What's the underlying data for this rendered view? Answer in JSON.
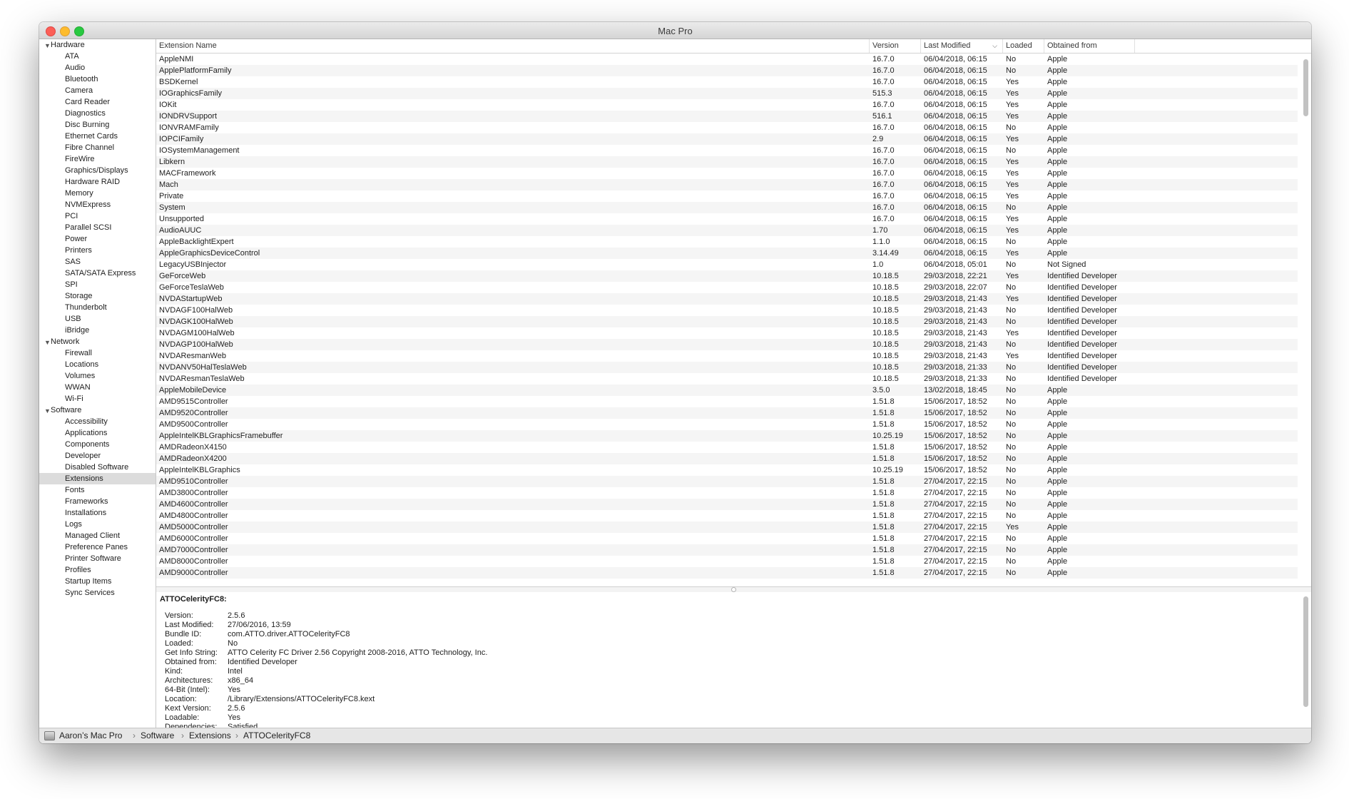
{
  "window": {
    "title": "Mac Pro"
  },
  "sidebar": {
    "items": [
      {
        "label": "Hardware",
        "kind": "cat"
      },
      {
        "label": "ATA",
        "kind": "child"
      },
      {
        "label": "Audio",
        "kind": "child"
      },
      {
        "label": "Bluetooth",
        "kind": "child"
      },
      {
        "label": "Camera",
        "kind": "child"
      },
      {
        "label": "Card Reader",
        "kind": "child"
      },
      {
        "label": "Diagnostics",
        "kind": "child"
      },
      {
        "label": "Disc Burning",
        "kind": "child"
      },
      {
        "label": "Ethernet Cards",
        "kind": "child"
      },
      {
        "label": "Fibre Channel",
        "kind": "child"
      },
      {
        "label": "FireWire",
        "kind": "child"
      },
      {
        "label": "Graphics/Displays",
        "kind": "child"
      },
      {
        "label": "Hardware RAID",
        "kind": "child"
      },
      {
        "label": "Memory",
        "kind": "child"
      },
      {
        "label": "NVMExpress",
        "kind": "child"
      },
      {
        "label": "PCI",
        "kind": "child"
      },
      {
        "label": "Parallel SCSI",
        "kind": "child"
      },
      {
        "label": "Power",
        "kind": "child"
      },
      {
        "label": "Printers",
        "kind": "child"
      },
      {
        "label": "SAS",
        "kind": "child"
      },
      {
        "label": "SATA/SATA Express",
        "kind": "child"
      },
      {
        "label": "SPI",
        "kind": "child"
      },
      {
        "label": "Storage",
        "kind": "child"
      },
      {
        "label": "Thunderbolt",
        "kind": "child"
      },
      {
        "label": "USB",
        "kind": "child"
      },
      {
        "label": "iBridge",
        "kind": "child"
      },
      {
        "label": "Network",
        "kind": "cat"
      },
      {
        "label": "Firewall",
        "kind": "child"
      },
      {
        "label": "Locations",
        "kind": "child"
      },
      {
        "label": "Volumes",
        "kind": "child"
      },
      {
        "label": "WWAN",
        "kind": "child"
      },
      {
        "label": "Wi-Fi",
        "kind": "child"
      },
      {
        "label": "Software",
        "kind": "cat"
      },
      {
        "label": "Accessibility",
        "kind": "child"
      },
      {
        "label": "Applications",
        "kind": "child"
      },
      {
        "label": "Components",
        "kind": "child"
      },
      {
        "label": "Developer",
        "kind": "child"
      },
      {
        "label": "Disabled Software",
        "kind": "child"
      },
      {
        "label": "Extensions",
        "kind": "child",
        "selected": true
      },
      {
        "label": "Fonts",
        "kind": "child"
      },
      {
        "label": "Frameworks",
        "kind": "child"
      },
      {
        "label": "Installations",
        "kind": "child"
      },
      {
        "label": "Logs",
        "kind": "child"
      },
      {
        "label": "Managed Client",
        "kind": "child"
      },
      {
        "label": "Preference Panes",
        "kind": "child"
      },
      {
        "label": "Printer Software",
        "kind": "child"
      },
      {
        "label": "Profiles",
        "kind": "child"
      },
      {
        "label": "Startup Items",
        "kind": "child"
      },
      {
        "label": "Sync Services",
        "kind": "child"
      }
    ]
  },
  "table": {
    "columns": [
      "Extension Name",
      "Version",
      "Last Modified",
      "Loaded",
      "Obtained from"
    ],
    "sort_icon": "chevron-down-icon",
    "rows": [
      [
        "AppleNMI",
        "16.7.0",
        "06/04/2018, 06:15",
        "No",
        "Apple"
      ],
      [
        "ApplePlatformFamily",
        "16.7.0",
        "06/04/2018, 06:15",
        "No",
        "Apple"
      ],
      [
        "BSDKernel",
        "16.7.0",
        "06/04/2018, 06:15",
        "Yes",
        "Apple"
      ],
      [
        "IOGraphicsFamily",
        "515.3",
        "06/04/2018, 06:15",
        "Yes",
        "Apple"
      ],
      [
        "IOKit",
        "16.7.0",
        "06/04/2018, 06:15",
        "Yes",
        "Apple"
      ],
      [
        "IONDRVSupport",
        "516.1",
        "06/04/2018, 06:15",
        "Yes",
        "Apple"
      ],
      [
        "IONVRAMFamily",
        "16.7.0",
        "06/04/2018, 06:15",
        "No",
        "Apple"
      ],
      [
        "IOPCIFamily",
        "2.9",
        "06/04/2018, 06:15",
        "Yes",
        "Apple"
      ],
      [
        "IOSystemManagement",
        "16.7.0",
        "06/04/2018, 06:15",
        "No",
        "Apple"
      ],
      [
        "Libkern",
        "16.7.0",
        "06/04/2018, 06:15",
        "Yes",
        "Apple"
      ],
      [
        "MACFramework",
        "16.7.0",
        "06/04/2018, 06:15",
        "Yes",
        "Apple"
      ],
      [
        "Mach",
        "16.7.0",
        "06/04/2018, 06:15",
        "Yes",
        "Apple"
      ],
      [
        "Private",
        "16.7.0",
        "06/04/2018, 06:15",
        "Yes",
        "Apple"
      ],
      [
        "System",
        "16.7.0",
        "06/04/2018, 06:15",
        "No",
        "Apple"
      ],
      [
        "Unsupported",
        "16.7.0",
        "06/04/2018, 06:15",
        "Yes",
        "Apple"
      ],
      [
        "AudioAUUC",
        "1.70",
        "06/04/2018, 06:15",
        "Yes",
        "Apple"
      ],
      [
        "AppleBacklightExpert",
        "1.1.0",
        "06/04/2018, 06:15",
        "No",
        "Apple"
      ],
      [
        "AppleGraphicsDeviceControl",
        "3.14.49",
        "06/04/2018, 06:15",
        "Yes",
        "Apple"
      ],
      [
        "LegacyUSBInjector",
        "1.0",
        "06/04/2018, 05:01",
        "No",
        "Not Signed"
      ],
      [
        "GeForceWeb",
        "10.18.5",
        "29/03/2018, 22:21",
        "Yes",
        "Identified Developer"
      ],
      [
        "GeForceTeslaWeb",
        "10.18.5",
        "29/03/2018, 22:07",
        "No",
        "Identified Developer"
      ],
      [
        "NVDAStartupWeb",
        "10.18.5",
        "29/03/2018, 21:43",
        "Yes",
        "Identified Developer"
      ],
      [
        "NVDAGF100HalWeb",
        "10.18.5",
        "29/03/2018, 21:43",
        "No",
        "Identified Developer"
      ],
      [
        "NVDAGK100HalWeb",
        "10.18.5",
        "29/03/2018, 21:43",
        "No",
        "Identified Developer"
      ],
      [
        "NVDAGM100HalWeb",
        "10.18.5",
        "29/03/2018, 21:43",
        "Yes",
        "Identified Developer"
      ],
      [
        "NVDAGP100HalWeb",
        "10.18.5",
        "29/03/2018, 21:43",
        "No",
        "Identified Developer"
      ],
      [
        "NVDAResmanWeb",
        "10.18.5",
        "29/03/2018, 21:43",
        "Yes",
        "Identified Developer"
      ],
      [
        "NVDANV50HalTeslaWeb",
        "10.18.5",
        "29/03/2018, 21:33",
        "No",
        "Identified Developer"
      ],
      [
        "NVDAResmanTeslaWeb",
        "10.18.5",
        "29/03/2018, 21:33",
        "No",
        "Identified Developer"
      ],
      [
        "AppleMobileDevice",
        "3.5.0",
        "13/02/2018, 18:45",
        "No",
        "Apple"
      ],
      [
        "AMD9515Controller",
        "1.51.8",
        "15/06/2017, 18:52",
        "No",
        "Apple"
      ],
      [
        "AMD9520Controller",
        "1.51.8",
        "15/06/2017, 18:52",
        "No",
        "Apple"
      ],
      [
        "AMD9500Controller",
        "1.51.8",
        "15/06/2017, 18:52",
        "No",
        "Apple"
      ],
      [
        "AppleIntelKBLGraphicsFramebuffer",
        "10.25.19",
        "15/06/2017, 18:52",
        "No",
        "Apple"
      ],
      [
        "AMDRadeonX4150",
        "1.51.8",
        "15/06/2017, 18:52",
        "No",
        "Apple"
      ],
      [
        "AMDRadeonX4200",
        "1.51.8",
        "15/06/2017, 18:52",
        "No",
        "Apple"
      ],
      [
        "AppleIntelKBLGraphics",
        "10.25.19",
        "15/06/2017, 18:52",
        "No",
        "Apple"
      ],
      [
        "AMD9510Controller",
        "1.51.8",
        "27/04/2017, 22:15",
        "No",
        "Apple"
      ],
      [
        "AMD3800Controller",
        "1.51.8",
        "27/04/2017, 22:15",
        "No",
        "Apple"
      ],
      [
        "AMD4600Controller",
        "1.51.8",
        "27/04/2017, 22:15",
        "No",
        "Apple"
      ],
      [
        "AMD4800Controller",
        "1.51.8",
        "27/04/2017, 22:15",
        "No",
        "Apple"
      ],
      [
        "AMD5000Controller",
        "1.51.8",
        "27/04/2017, 22:15",
        "Yes",
        "Apple"
      ],
      [
        "AMD6000Controller",
        "1.51.8",
        "27/04/2017, 22:15",
        "No",
        "Apple"
      ],
      [
        "AMD7000Controller",
        "1.51.8",
        "27/04/2017, 22:15",
        "No",
        "Apple"
      ],
      [
        "AMD8000Controller",
        "1.51.8",
        "27/04/2017, 22:15",
        "No",
        "Apple"
      ],
      [
        "AMD9000Controller",
        "1.51.8",
        "27/04/2017, 22:15",
        "No",
        "Apple"
      ]
    ]
  },
  "detail": {
    "title": "ATTOCelerityFC8:",
    "fields": [
      [
        "Version:",
        "2.5.6"
      ],
      [
        "Last Modified:",
        "27/06/2016, 13:59"
      ],
      [
        "Bundle ID:",
        "com.ATTO.driver.ATTOCelerityFC8"
      ],
      [
        "Loaded:",
        "No"
      ],
      [
        "Get Info String:",
        "ATTO Celerity FC Driver 2.56 Copyright 2008-2016, ATTO Technology, Inc."
      ],
      [
        "Obtained from:",
        "Identified Developer"
      ],
      [
        "Kind:",
        "Intel"
      ],
      [
        "Architectures:",
        "x86_64"
      ],
      [
        "64-Bit (Intel):",
        "Yes"
      ],
      [
        "Location:",
        "/Library/Extensions/ATTOCelerityFC8.kext"
      ],
      [
        "Kext Version:",
        "2.5.6"
      ],
      [
        "Loadable:",
        "Yes"
      ],
      [
        "Dependencies:",
        "Satisfied"
      ]
    ]
  },
  "pathbar": {
    "icon": "drive-icon",
    "crumbs": [
      "Aaron’s Mac Pro",
      "Software",
      "Extensions",
      "ATTOCelerityFC8"
    ],
    "separator": "›"
  }
}
